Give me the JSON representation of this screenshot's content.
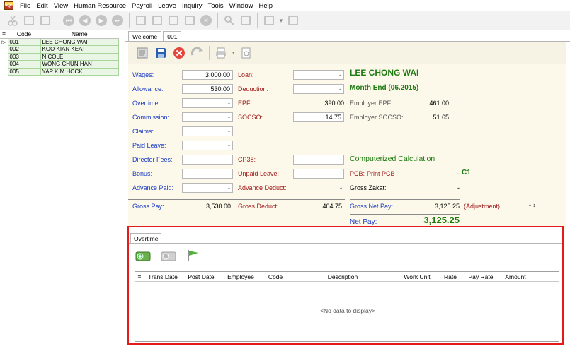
{
  "menu": [
    "File",
    "Edit",
    "View",
    "Human Resource",
    "Payroll",
    "Leave",
    "Inquiry",
    "Tools",
    "Window",
    "Help"
  ],
  "app_logo_text": "SQL",
  "employee_grid": {
    "headers": [
      "Code",
      "Name"
    ],
    "rows": [
      {
        "code": "001",
        "name": "LEE CHONG WAI"
      },
      {
        "code": "002",
        "name": "KOO KIAN KEAT"
      },
      {
        "code": "003",
        "name": "NICOLE"
      },
      {
        "code": "004",
        "name": "WONG CHUN HAN"
      },
      {
        "code": "005",
        "name": "YAP KIM HOCK"
      }
    ]
  },
  "tabs": [
    "Welcome",
    "001"
  ],
  "form": {
    "wages_label": "Wages:",
    "wages_value": "3,000.00",
    "allowance_label": "Allowance:",
    "allowance_value": "530.00",
    "overtime_label": "Overtime:",
    "commission_label": "Commission:",
    "claims_label": "Claims:",
    "paid_leave_label": "Paid Leave:",
    "director_fees_label": "Director Fees:",
    "bonus_label": "Bonus:",
    "advance_paid_label": "Advance Paid:",
    "loan_label": "Loan:",
    "deduction_label": "Deduction:",
    "epf_label": "EPF:",
    "epf_value": "390.00",
    "socso_label": "SOCSO:",
    "socso_value": "14.75",
    "cp38_label": "CP38:",
    "unpaid_leave_label": "Unpaid Leave:",
    "advance_deduct_label": "Advance Deduct:",
    "employee_name": "LEE CHONG WAI",
    "period": "Month End (06.2015)",
    "employer_epf_label": "Employer EPF:",
    "employer_epf_value": "461.00",
    "employer_socso_label": "Employer SOCSO:",
    "employer_socso_value": "51.65",
    "computerized": "Computerized Calculation",
    "pcb_label": "PCB:",
    "print_pcb": "Print PCB",
    "pcb_code": "C1",
    "gross_zakat_label": "Gross Zakat:",
    "gross_pay_label": "Gross Pay:",
    "gross_pay_value": "3,530.00",
    "gross_deduct_label": "Gross Deduct:",
    "gross_deduct_value": "404.75",
    "gross_net_pay_label": "Gross Net Pay:",
    "gross_net_pay_value": "3,125.25",
    "adjustment_label": "(Adjustment)",
    "net_pay_label": "Net Pay:",
    "net_pay_value": "3,125.25",
    "dash": "-"
  },
  "overtime": {
    "tab": "Overtime",
    "columns": [
      "Trans Date",
      "Post Date",
      "Employee",
      "Code",
      "Description",
      "Work Unit",
      "Rate",
      "Pay Rate",
      "Amount"
    ],
    "empty_text": "<No data to display>"
  }
}
